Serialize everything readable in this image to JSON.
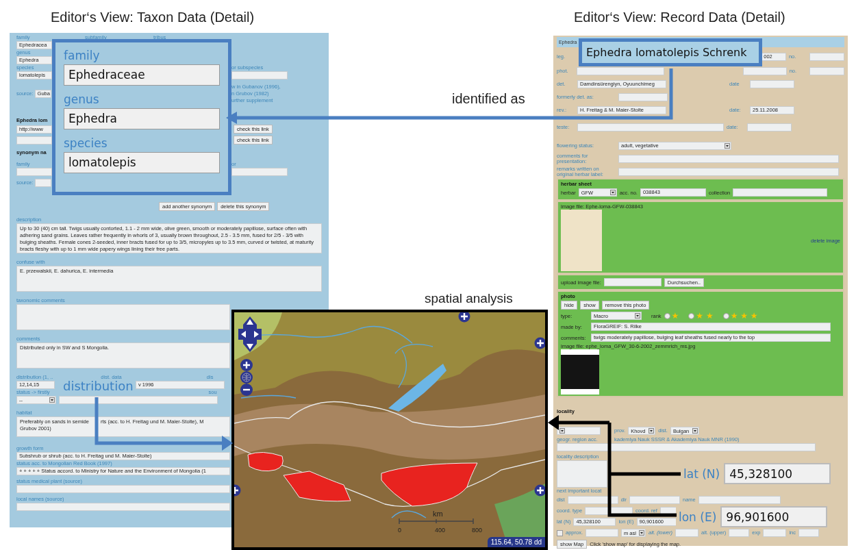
{
  "titles": {
    "taxon_view": "Editor‘s View: Taxon Data (Detail)",
    "record_view": "Editor‘s View: Record Data (Detail)"
  },
  "taxon_form": {
    "top_labels": [
      "family",
      "subfamily",
      "tribus"
    ],
    "family_value": "Ephedracea",
    "genus_label": "genus",
    "genus_value": "Ephedra",
    "species_label": "species",
    "species_value": "lomatolepis",
    "subspecies_label": "or subspecies",
    "source_label": "source:",
    "source_value": "Guba",
    "source_note": [
      "w in Gubanov (1996),",
      "n Grubov (1982)",
      "urther supplement"
    ],
    "link_heading": "Ephedra lom",
    "link_value": "http://www",
    "check_buttons": [
      "check this link",
      "check this link"
    ],
    "synonym_heading": "synonym na",
    "synonym_family_label": "family",
    "synonym_rank_label": "or",
    "synonym_source_label": "source:",
    "synonym_buttons": [
      "add another synonym",
      "delete this synonym"
    ],
    "description_label": "description",
    "description": "Up to 30 (40) cm tall. Twigs usually contorted, 1.1 - 2 mm wide, olive green, smooth or moderately papillose, surface often with adhering sand grains. Leaves rather frequently in whorls of 3, usually brown throughout, 2.5 - 3.5 mm, fused for 2/5 - 3/5 with bulging sheaths. Female cones 2-seeded, inner bracts fused for up to 3/5, micropyles up to 3.5 mm, curved or twisted, at maturity bracts fleshy with up to 1 mm wide papery wings lining their free parts.",
    "confuse_label": "confuse with",
    "confuse": "E. przewalskii,  E. dahurica, E. intermedia",
    "taxonomic_comments_label": "taxonomic comments",
    "comments_label": "comments",
    "comments": "Distributed only in SW and S Mongolia.",
    "distribution_label": "distribution (1, ..",
    "distribution_value": "12,14,15",
    "dist_data_label": "dist. data",
    "dist_data_value": "v 1996",
    "dist_label_3": "dis",
    "status_label": "status -> firstly",
    "status_value": "--",
    "status_source_label": "sou",
    "habitat_label": "habitat",
    "habitat_lines": [
      "Preferably on sands in semide",
      "rts (acc. to H. Freitag und M. Maier-Stolte), M",
      "Grubov 2001)"
    ],
    "growth_form_label": "growth form",
    "growth_form": "Subshrub or shrub  (acc. to H. Freitag und M. Maier-Stolte)",
    "red_book_label": "status acc. to Mongolian Red Book (1997)",
    "red_book": "+ + + + + Status accord. to Ministry for Nature and the Environment of Mongolia (1",
    "medical_label": "status medical plant (source)",
    "local_names_label": "local names (source)"
  },
  "taxon_callout": {
    "fields": [
      {
        "label": "family",
        "value": "Ephedraceae"
      },
      {
        "label": "genus",
        "value": "Ephedra"
      },
      {
        "label": "species",
        "value": "lomatolepis"
      }
    ]
  },
  "identified_as": "identified as",
  "record_form": {
    "header": "Ephedra",
    "leg_label": "leg.",
    "leg_date": "002",
    "no_label": "no.",
    "phot_label": "phot.",
    "phot_no_label": "no.",
    "det_label": "det.",
    "det_value": "Damdinsürengiyn, Oyuunchimeg",
    "det_date_label": "date",
    "formerly_label": "formerly det. as:",
    "rev_label": "rev.:",
    "rev_value": "H. Freitag & M. Maier-Stolte",
    "rev_date_label": "date:",
    "rev_date": "25.11.2008",
    "teste_label": "teste:",
    "teste_date_label": "date:",
    "flowering_label": "flowering status:",
    "flowering_value": "adult, vegetative",
    "comments_presentation_label": "comments for presentation:",
    "remarks_label": "remarks written on original herbar label:",
    "herbar_sheet": {
      "title": "herbar sheet",
      "herbar_label": "herbar",
      "herbar_value": "GFW",
      "acc_label": "acc. no.",
      "acc_value": "038843",
      "collection_label": "collection"
    },
    "image_file": "image file: Ephe-loma-GFW-038843",
    "delete_image": "delete image",
    "upload_label": "upload image file:",
    "browse_button": "Durchsuchen..",
    "photo": {
      "title": "photo",
      "buttons": [
        "hide",
        "show",
        "remove this photo"
      ],
      "type_label": "type:",
      "type_value": "Macro",
      "rank_label": "rank",
      "rank_options": [
        {
          "label": "★",
          "selected": false
        },
        {
          "label": "★ ★",
          "selected": false
        },
        {
          "label": "★ ★ ★",
          "selected": false
        }
      ],
      "made_by_label": "made by:",
      "made_by": "FloraGREIF: S. Rilke",
      "comments_label": "comments:",
      "comments": "twigs moderately papillose, bulging leaf sheaths fused nearly to the top",
      "image_file": "image file: ephe_loma_GFW_30-6-2002_zemmrich_ms.jpg"
    },
    "locality": {
      "title": "locality",
      "prov_label": "prov.",
      "prov_value": "Khovd",
      "dist_label": "dist.",
      "dist_value": "Bulgan",
      "geogr_label": [
        "geogr. region acc.",
        "kademiya Nauk SSSR & Akademiya Nauk MNR (1990)"
      ],
      "description_label": "locality description",
      "next_label": "next important locat",
      "dist_field_label": "dist",
      "dir_label": "dir",
      "name_label": "name",
      "coord_type_label": "coord. type",
      "coord_ref_label": "coord. ref",
      "lat_label": "lat (N)",
      "lat_value": "45,328100",
      "lon_label": "lon (E)",
      "lon_value": "90,901600",
      "approx_label": "approx.",
      "approx_checked": false,
      "unit_value": "m asl",
      "alt_lower_label": "alt. (lower)",
      "alt_upper_label": "alt. (upper)",
      "exp_label": "exp",
      "inc_label": "inc",
      "show_map_button": "show Map",
      "show_map_hint": "Click 'show map' for displaying the map."
    }
  },
  "record_callout": "Ephedra lomatolepis Schrenk",
  "spatial_analysis": "spatial analysis",
  "distribution_callout": "distribution",
  "map": {
    "scale_unit": "km",
    "scale_ticks": [
      "0",
      "400",
      "800"
    ],
    "coordinates": "115.64, 50.78 dd"
  },
  "coordinate_callouts": [
    {
      "label": "lat (N)",
      "value": "45,328100"
    },
    {
      "label": "lon (E)",
      "value": "96,901600"
    }
  ]
}
